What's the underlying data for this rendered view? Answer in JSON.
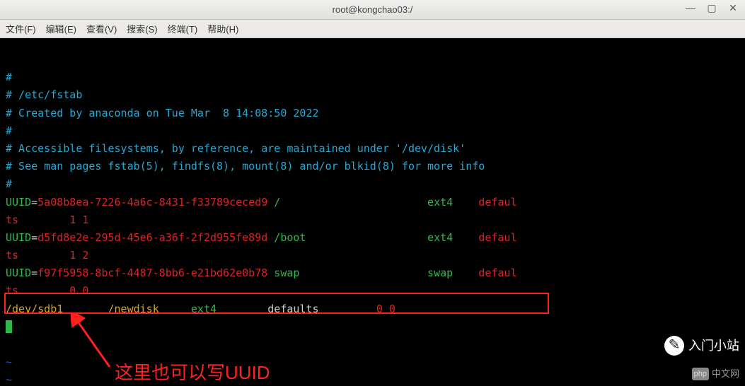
{
  "title": "root@kongchao03:/",
  "menu": {
    "file": "文件(F)",
    "edit": "编辑(E)",
    "view": "查看(V)",
    "search": "搜索(S)",
    "terminal": "终端(T)",
    "help": "帮助(H)"
  },
  "fstab": {
    "l1": "#",
    "l2": "# /etc/fstab",
    "l3": "# Created by anaconda on Tue Mar  8 14:08:50 2022",
    "l4": "#",
    "l5": "# Accessible filesystems, by reference, are maintained under '/dev/disk'",
    "l6": "# See man pages fstab(5), findfs(8), mount(8) and/or blkid(8) for more info",
    "l7": "#"
  },
  "entries": [
    {
      "uuid_label": "UUID",
      "eq": "=",
      "uuid": "5a08b8ea-7226-4a6c-8431-f33789ceced9",
      "mnt": "/",
      "fs": "ext4",
      "opt": "defaul",
      "tail": "ts        1 1"
    },
    {
      "uuid_label": "UUID",
      "eq": "=",
      "uuid": "d5fd8e2e-295d-45e6-a36f-2f2d955fe89d",
      "mnt": "/boot",
      "fs": "ext4",
      "opt": "defaul",
      "tail": "ts        1 2"
    },
    {
      "uuid_label": "UUID",
      "eq": "=",
      "uuid": "f97f5958-8bcf-4487-8bb6-e21bd62e0b78",
      "mnt": "swap",
      "fs": "swap",
      "opt": "defaul",
      "tail": "ts        0 0"
    }
  ],
  "newline": {
    "dev": "/dev/sdb1",
    "mnt": "/newdisk",
    "fs": "ext4",
    "opts": "defaults",
    "dump": "0 0"
  },
  "annotation": "这里也可以写UUID",
  "watermark1": "入门小站",
  "watermark2": "中文网",
  "watermark2_logo": "php"
}
